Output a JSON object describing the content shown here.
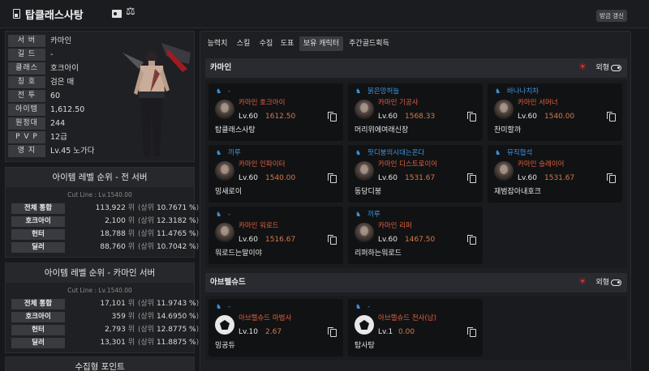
{
  "header": {
    "title": "탑클래스사탕",
    "update_button": "방금 갱신"
  },
  "profile": {
    "rows": [
      {
        "label": "서 버",
        "value": "카마인"
      },
      {
        "label": "길 드",
        "value": "-"
      },
      {
        "label": "클래스",
        "value": "호크아이"
      },
      {
        "label": "칭 호",
        "value": "검은 매"
      },
      {
        "label": "전 투",
        "value": "60"
      },
      {
        "label": "아이템",
        "value": "1,612.50"
      },
      {
        "label": "원정대",
        "value": "244"
      },
      {
        "label": "P V P",
        "value": "12급"
      },
      {
        "label": "영 지",
        "value": "Lv.45 노가다"
      }
    ]
  },
  "rank_all": {
    "title": "아이템 레벨 순위 - 전 서버",
    "cutline": "Cut Line : Lv.1540.00",
    "rows": [
      {
        "label": "전체 통합",
        "rank": "113,922",
        "pct": "10.7671 %"
      },
      {
        "label": "호크아이",
        "rank": "2,100",
        "pct": "12.3182 %"
      },
      {
        "label": "헌터",
        "rank": "18,788",
        "pct": "11.4765 %"
      },
      {
        "label": "딜러",
        "rank": "88,760",
        "pct": "10.7042 %"
      }
    ]
  },
  "rank_server": {
    "title": "아이템 레벨 순위 - 카마인 서버",
    "cutline": "Cut Line : Lv.1540.00",
    "rows": [
      {
        "label": "전체 통합",
        "rank": "17,101",
        "pct": "11.9743 %"
      },
      {
        "label": "호크아이",
        "rank": "359",
        "pct": "14.6950 %"
      },
      {
        "label": "헌터",
        "rank": "2,793",
        "pct": "12.8775 %"
      },
      {
        "label": "딜러",
        "rank": "13,301",
        "pct": "11.8875 %"
      }
    ]
  },
  "rank_units": {
    "rank_suffix": "위",
    "pct_prefix": "(상위",
    "pct_suffix": ")"
  },
  "collection": {
    "title": "수집형 포인트"
  },
  "tabs": [
    "능력치",
    "스킬",
    "수집",
    "도표",
    "보유 캐릭터",
    "주간골드획득"
  ],
  "active_tab": "보유 캐릭터",
  "appearance_label": "외형",
  "servers": [
    {
      "name": "카마인",
      "characters": [
        {
          "guild": "-",
          "server": "카마인",
          "class": "호크아이",
          "level": "Lv.60",
          "item_level": "1612.50",
          "name": "탑클래스사탕"
        },
        {
          "guild": "붉은망허늘",
          "server": "카마인",
          "class": "기공사",
          "level": "Lv.60",
          "item_level": "1568.33",
          "name": "머리위에여래신장"
        },
        {
          "guild": "바나나치차",
          "server": "카마인",
          "class": "서머너",
          "level": "Lv.60",
          "item_level": "1540.00",
          "name": "찬미할까"
        },
        {
          "guild": "끼루",
          "server": "카마인",
          "class": "인파이터",
          "level": "Lv.60",
          "item_level": "1540.00",
          "name": "밍새로이"
        },
        {
          "guild": "팟디붕의시대는온다",
          "server": "카마인",
          "class": "디스트로이어",
          "level": "Lv.60",
          "item_level": "1531.67",
          "name": "동당디붕"
        },
        {
          "guild": "뮤직협석",
          "server": "카마인",
          "class": "슬레이어",
          "level": "Lv.60",
          "item_level": "1531.67",
          "name": "재범잡아내호크"
        },
        {
          "guild": "-",
          "server": "카마인",
          "class": "워로드",
          "level": "Lv.60",
          "item_level": "1516.67",
          "name": "워로드는말이야"
        },
        {
          "guild": "끼루",
          "server": "카마인",
          "class": "리퍼",
          "level": "Lv.60",
          "item_level": "1467.50",
          "name": "리퍼하는워로드"
        }
      ]
    },
    {
      "name": "아브렐슈드",
      "characters": [
        {
          "guild": "-",
          "server": "아브렐슈드",
          "class": "마법사",
          "level": "Lv.10",
          "item_level": "2.67",
          "name": "밍공듀"
        },
        {
          "guild": "-",
          "server": "아브렐슈드",
          "class": "전사(남)",
          "level": "Lv.1",
          "item_level": "0.00",
          "name": "탑사탕"
        }
      ]
    }
  ]
}
